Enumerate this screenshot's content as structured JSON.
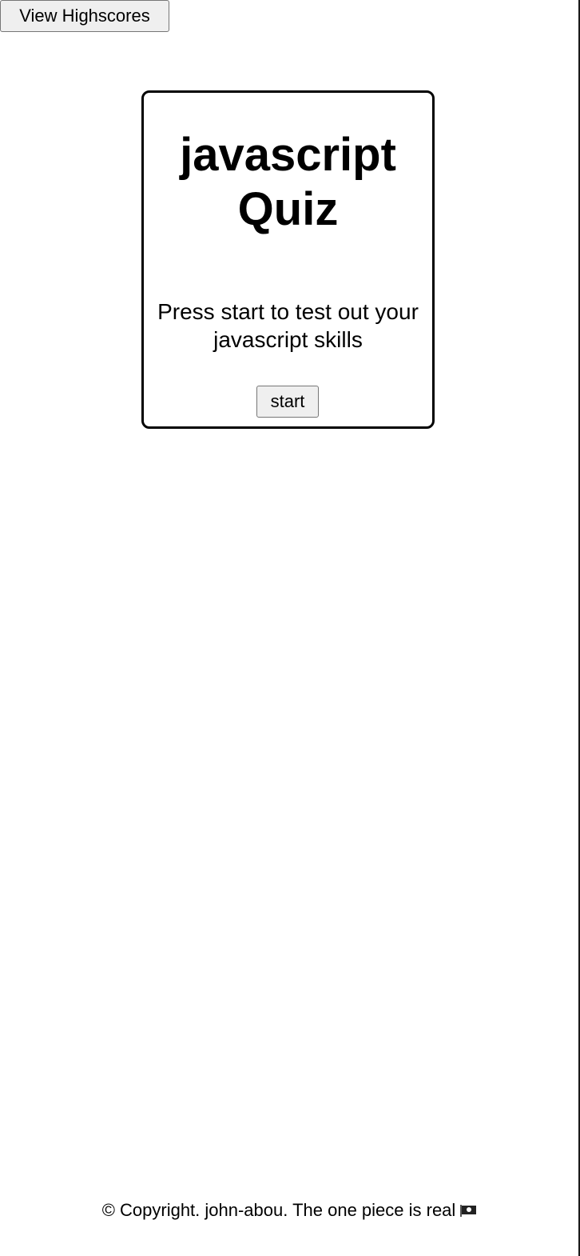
{
  "header": {
    "highscores_label": "View Highscores"
  },
  "quiz": {
    "title": "javascript Quiz",
    "description": "Press start to test out your javascript skills",
    "start_label": "start"
  },
  "footer": {
    "copyright_text": "© Copyright. john-abou. The one piece is real",
    "flag_icon": "pirate-flag-icon"
  }
}
